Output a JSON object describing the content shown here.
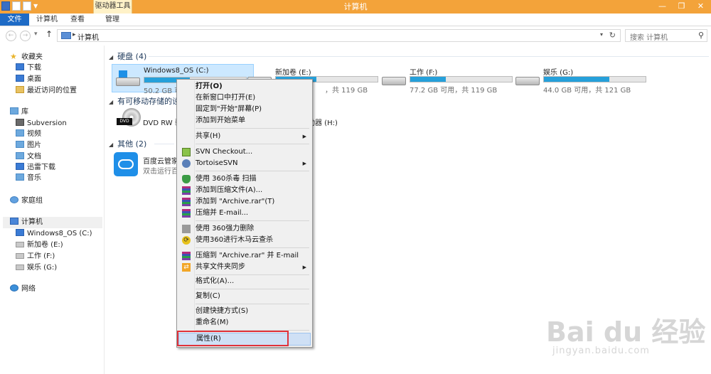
{
  "window": {
    "title": "计算机",
    "contextual_tab": "驱动器工具",
    "controls": {
      "minimize": "—",
      "maximize": "❐",
      "close": "✕"
    }
  },
  "ribbon": {
    "tabs": [
      "文件",
      "计算机",
      "查看",
      "管理"
    ]
  },
  "address": {
    "path": "计算机",
    "separator": "▸",
    "search_placeholder": "搜索 计算机"
  },
  "nav_icons": {
    "back": "arrow-left-icon",
    "forward": "arrow-right-icon",
    "up": "arrow-up-icon",
    "refresh": "refresh-icon",
    "search": "search-icon"
  },
  "sidebar": {
    "favorites_header": "收藏夹",
    "favorites": [
      "下载",
      "桌面",
      "最近访问的位置"
    ],
    "libraries_header": "库",
    "libraries": [
      "Subversion",
      "视频",
      "图片",
      "文档",
      "迅雷下载",
      "音乐"
    ],
    "homegroup": "家庭组",
    "computer": "计算机",
    "drives": [
      "Windows8_OS (C:)",
      "新加卷 (E:)",
      "工作 (F:)",
      "娱乐 (G:)"
    ],
    "network": "网络"
  },
  "groups": {
    "hdd": "硬盘 (4)",
    "removable": "有可移动存储的设",
    "other": "其他 (2)"
  },
  "drives": [
    {
      "name": "Windows8_OS (C:)",
      "info": "50.2 GB 可用",
      "used_fraction": 0.45
    },
    {
      "name": "新加卷 (E:)",
      "info": "，共 119 GB",
      "used_fraction": 0.4
    },
    {
      "name": "工作 (F:)",
      "info": "77.2 GB 可用，共 119 GB",
      "used_fraction": 0.35
    },
    {
      "name": "娱乐 (G:)",
      "info": "44.0 GB 可用，共 121 GB",
      "used_fraction": 0.64
    }
  ],
  "removable": [
    {
      "name": "DVD RW 驱"
    },
    {
      "name": "动器 (H:)"
    }
  ],
  "other": [
    {
      "name": "百度云管家",
      "info": "双击运行百度"
    }
  ],
  "context_menu": {
    "items": [
      {
        "label": "打开(O)",
        "bold": true
      },
      {
        "label": "在新窗口中打开(E)"
      },
      {
        "label": "固定到\"开始\"屏幕(P)"
      },
      {
        "label": "添加到开始菜单"
      },
      {
        "label": "共享(H)",
        "submenu": true
      },
      {
        "label": "SVN Checkout..."
      },
      {
        "label": "TortoiseSVN",
        "submenu": true
      },
      {
        "label": "使用 360杀毒 扫描"
      },
      {
        "label": "添加到压缩文件(A)..."
      },
      {
        "label": "添加到 \"Archive.rar\"(T)"
      },
      {
        "label": "压缩并 E-mail..."
      },
      {
        "label": "使用 360强力删除"
      },
      {
        "label": "使用360进行木马云查杀"
      },
      {
        "label": "压缩到 \"Archive.rar\" 并 E-mail"
      },
      {
        "label": "共享文件夹同步",
        "submenu": true
      },
      {
        "label": "格式化(A)..."
      },
      {
        "label": "复制(C)"
      },
      {
        "label": "创建快捷方式(S)"
      },
      {
        "label": "重命名(M)"
      },
      {
        "label": "属性(R)",
        "highlighted": true
      }
    ],
    "submenu_arrow": "▶"
  },
  "watermark": {
    "main": "Bai du 经验",
    "sub": "jingyan.baidu.com"
  },
  "colors": {
    "titlebar": "#f3a33a",
    "file_tab": "#1e6bc6",
    "drive_fill": "#26a0da",
    "highlight_box": "#e0323a"
  }
}
